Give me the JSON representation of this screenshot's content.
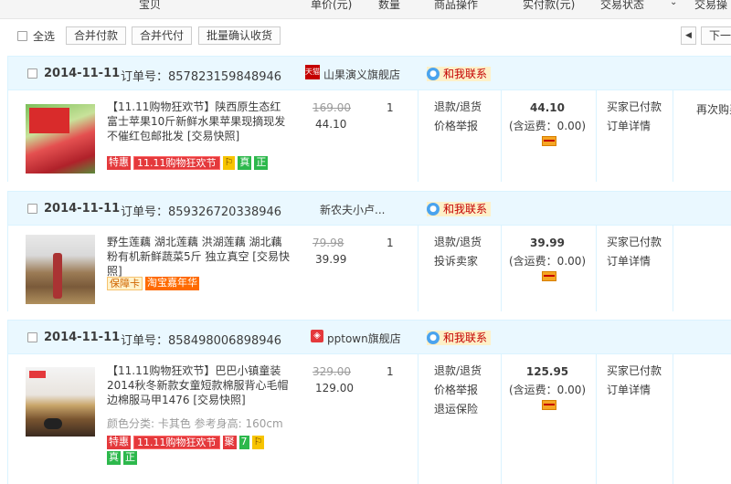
{
  "header": {
    "col_item": "宝贝",
    "col_unit_price": "单价(元)",
    "col_qty": "数量",
    "col_ops": "商品操作",
    "col_paid": "实付款(元)",
    "col_status": "交易状态",
    "col_more": "交易操"
  },
  "toolbar": {
    "select_all": "全选",
    "merge_pay": "合并付款",
    "merge_proxy": "合并代付",
    "batch_confirm": "批量确认收货",
    "page_next": "下一"
  },
  "contact_label": "和我联系",
  "orders": [
    {
      "date": "2014-11-11",
      "order_no": "订单号：857823159848946",
      "shop": "山果演义旗舰店",
      "title": "【11.11购物狂欢节】陕西原生态红富士苹果10斤新鲜水果苹果现摘现发不催红包邮批发 [交易快照]",
      "orig_price": "169.00",
      "price": "44.10",
      "qty": "1",
      "ops": [
        "退款/退货",
        "价格举报"
      ],
      "total": "44.10",
      "shipping": "(含运费：0.00)",
      "status": [
        "买家已付款",
        "订单详情"
      ],
      "action": "再次购买",
      "tags": [
        "特惠",
        "11.11购物狂欢节",
        "⚐",
        "真",
        "正"
      ]
    },
    {
      "date": "2014-11-11",
      "order_no": "订单号：859326720338946",
      "shop": "新农夫小卢...",
      "title": "野生莲藕 湖北莲藕 洪湖莲藕 湖北藕 粉有机新鲜蔬菜5斤 独立真空 [交易快照]",
      "orig_price": "79.98",
      "price": "39.99",
      "qty": "1",
      "ops": [
        "退款/退货",
        "投诉卖家"
      ],
      "total": "39.99",
      "shipping": "(含运费：0.00)",
      "status": [
        "买家已付款",
        "订单详情"
      ],
      "tags": [
        "保障卡",
        "淘宝嘉年华"
      ]
    },
    {
      "date": "2014-11-11",
      "order_no": "订单号：858498006898946",
      "shop": "pptown旗舰店",
      "title": "【11.11购物狂欢节】巴巴小镇童装2014秋冬新款女童短款棉服背心毛帽边棉服马甲1476 [交易快照]",
      "attr": "颜色分类: 卡其色  参考身高: 160cm",
      "orig_price": "329.00",
      "price": "129.00",
      "qty": "1",
      "ops": [
        "退款/退货",
        "价格举报",
        "退运保险"
      ],
      "total": "125.95",
      "shipping": "(含运费：0.00)",
      "status": [
        "买家已付款",
        "订单详情"
      ],
      "tags": [
        "特惠",
        "11.11购物狂欢节",
        "聚",
        "7",
        "⚐",
        "真",
        "正"
      ]
    }
  ],
  "colors": {
    "header_bg": "#eaf8ff",
    "border": "#daf3ff",
    "accent_red": "#e4393c",
    "contact_bg": "#fdf0c8"
  }
}
